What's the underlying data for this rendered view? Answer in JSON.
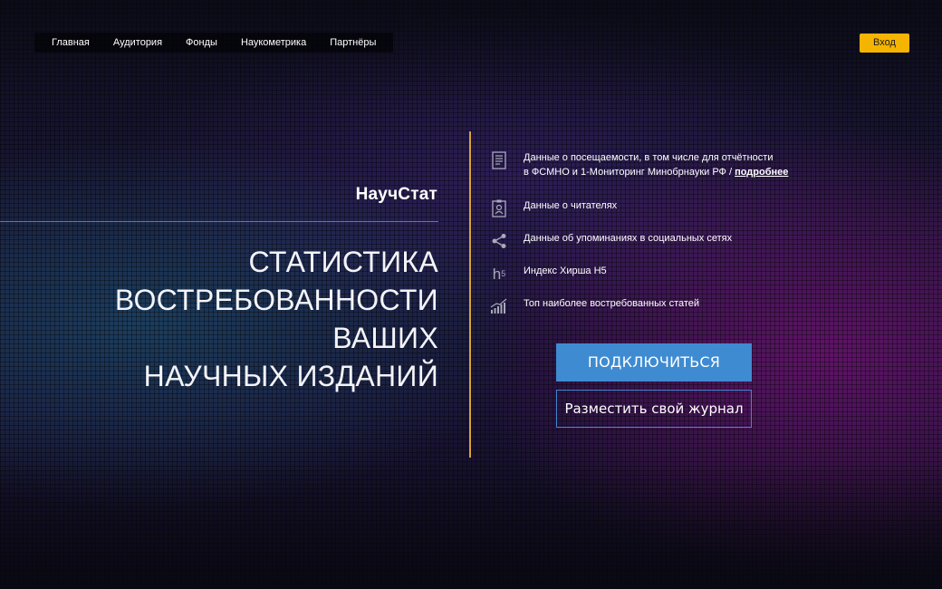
{
  "nav": {
    "items": [
      {
        "label": "Главная"
      },
      {
        "label": "Аудитория"
      },
      {
        "label": "Фонды"
      },
      {
        "label": "Наукометрика"
      },
      {
        "label": "Партнёры"
      }
    ],
    "login_label": "Вход"
  },
  "hero": {
    "brand": "НаучСтат",
    "headline_lines": [
      "СТАТИСТИКА",
      "ВОСТРЕБОВАННОСТИ",
      "ВАШИХ",
      "НАУЧНЫХ ИЗДАНИЙ"
    ]
  },
  "features": [
    {
      "icon": "document-icon",
      "line1": "Данные о посещаемости, в том числе для отчётности",
      "line2": "в ФСМНО и 1-Мониторинг Минобрнауки РФ / ",
      "link": "подробнее"
    },
    {
      "icon": "id-badge-icon",
      "text": "Данные о читателях"
    },
    {
      "icon": "share-icon",
      "text": "Данные об упоминаниях в социальных сетях"
    },
    {
      "icon": "h5-icon",
      "icon_text": "h",
      "icon_sup": "5",
      "text": "Индекс Хирша H5"
    },
    {
      "icon": "growth-chart-icon",
      "text": "Топ наиболее востребованных статей"
    }
  ],
  "actions": {
    "connect_label": "ПОДКЛЮЧИТЬСЯ",
    "place_journal_label": "Разместить свой журнал"
  },
  "colors": {
    "accent_yellow": "#f5b400",
    "divider_gold": "#d7a531",
    "button_blue": "#3f8bd1"
  }
}
